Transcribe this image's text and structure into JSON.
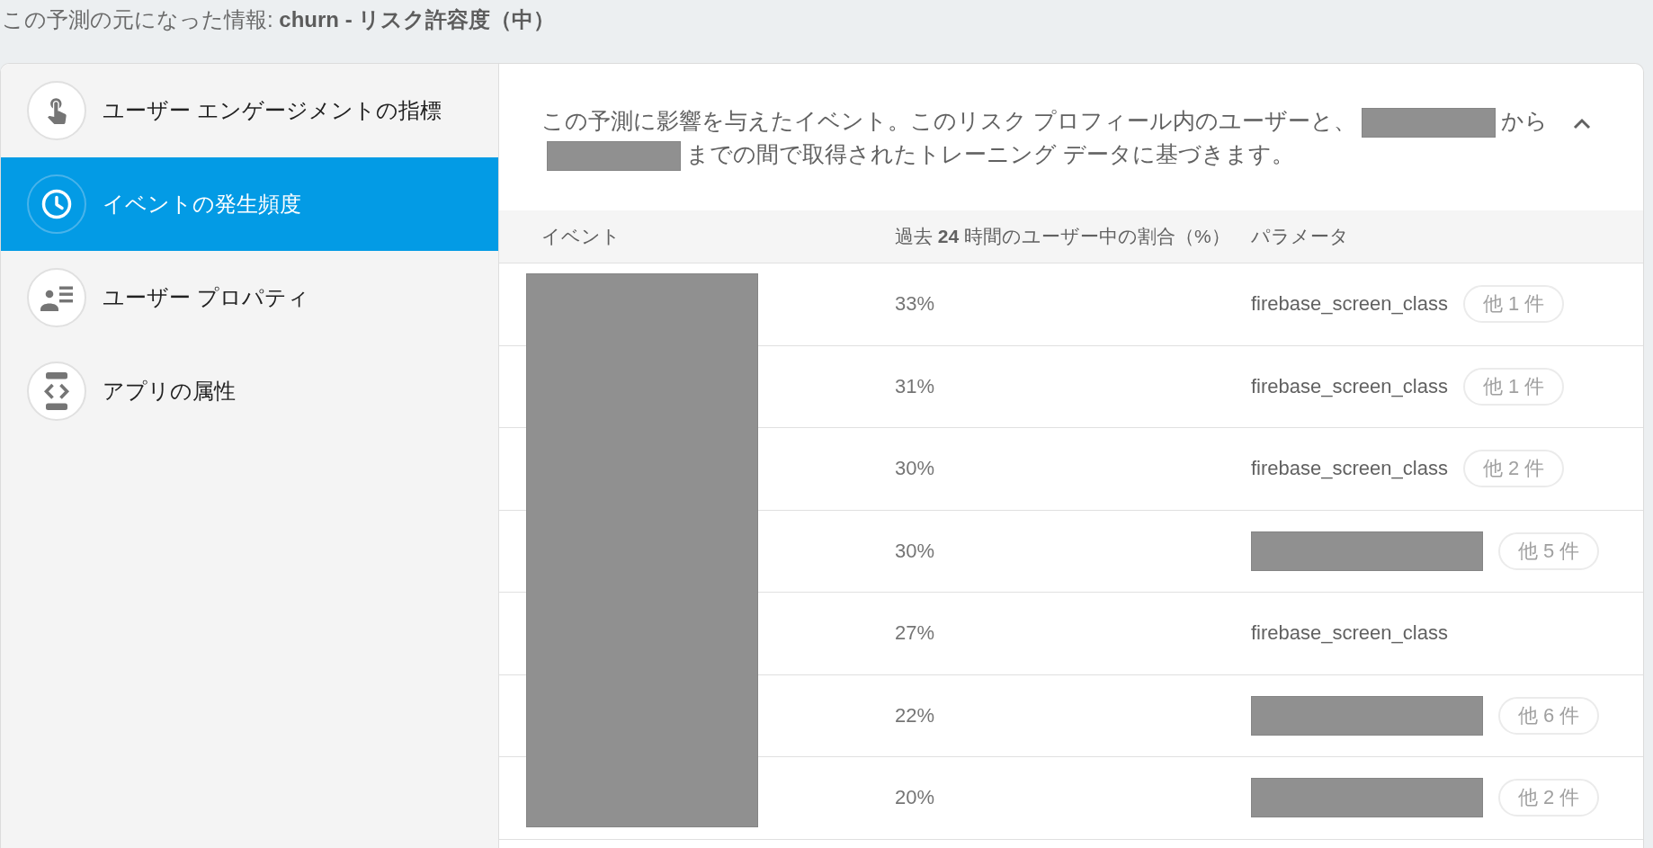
{
  "page_title": "この予測の元になった情報: **churn - リスク許容度（中）**",
  "sidebar": {
    "items": [
      {
        "label": "ユーザー エンゲージメントの指標",
        "selected": false
      },
      {
        "label": "イベントの発生頻度",
        "selected": true
      },
      {
        "label": "ユーザー プロパティ",
        "selected": false
      },
      {
        "label": "アプリの属性",
        "selected": false
      }
    ]
  },
  "details": {
    "expanded": true,
    "description": [
      {
        "kind": "text",
        "text": "この予測に影響を与えたイベント。このリスク プロフィール内のユーザーと、"
      },
      {
        "kind": "redacted"
      },
      {
        "kind": "text",
        "text": "から"
      },
      {
        "kind": "redacted"
      },
      {
        "kind": "text",
        "text": "までの間で取得されたトレーニング データに基づきます。"
      }
    ]
  },
  "table": {
    "columns": [
      "イベント",
      "過去 **24** 時間のユーザー中の割合（%）",
      "パラメータ"
    ],
    "event_redacted": true,
    "rows": [
      {
        "share": "33%",
        "parameter": {
          "kind": "text",
          "text": "firebase_screen_class"
        },
        "more": "他 1 件"
      },
      {
        "share": "31%",
        "parameter": {
          "kind": "text",
          "text": "firebase_screen_class"
        },
        "more": "他 1 件"
      },
      {
        "share": "30%",
        "parameter": {
          "kind": "text",
          "text": "firebase_screen_class"
        },
        "more": "他 2 件"
      },
      {
        "share": "30%",
        "parameter": {
          "kind": "redacted"
        },
        "more": "他 5 件"
      },
      {
        "share": "27%",
        "parameter": {
          "kind": "text",
          "text": "firebase_screen_class"
        }
      },
      {
        "share": "22%",
        "parameter": {
          "kind": "redacted"
        },
        "more": "他 6 件"
      },
      {
        "share": "20%",
        "parameter": {
          "kind": "redacted"
        },
        "more": "他 2 件"
      }
    ]
  }
}
